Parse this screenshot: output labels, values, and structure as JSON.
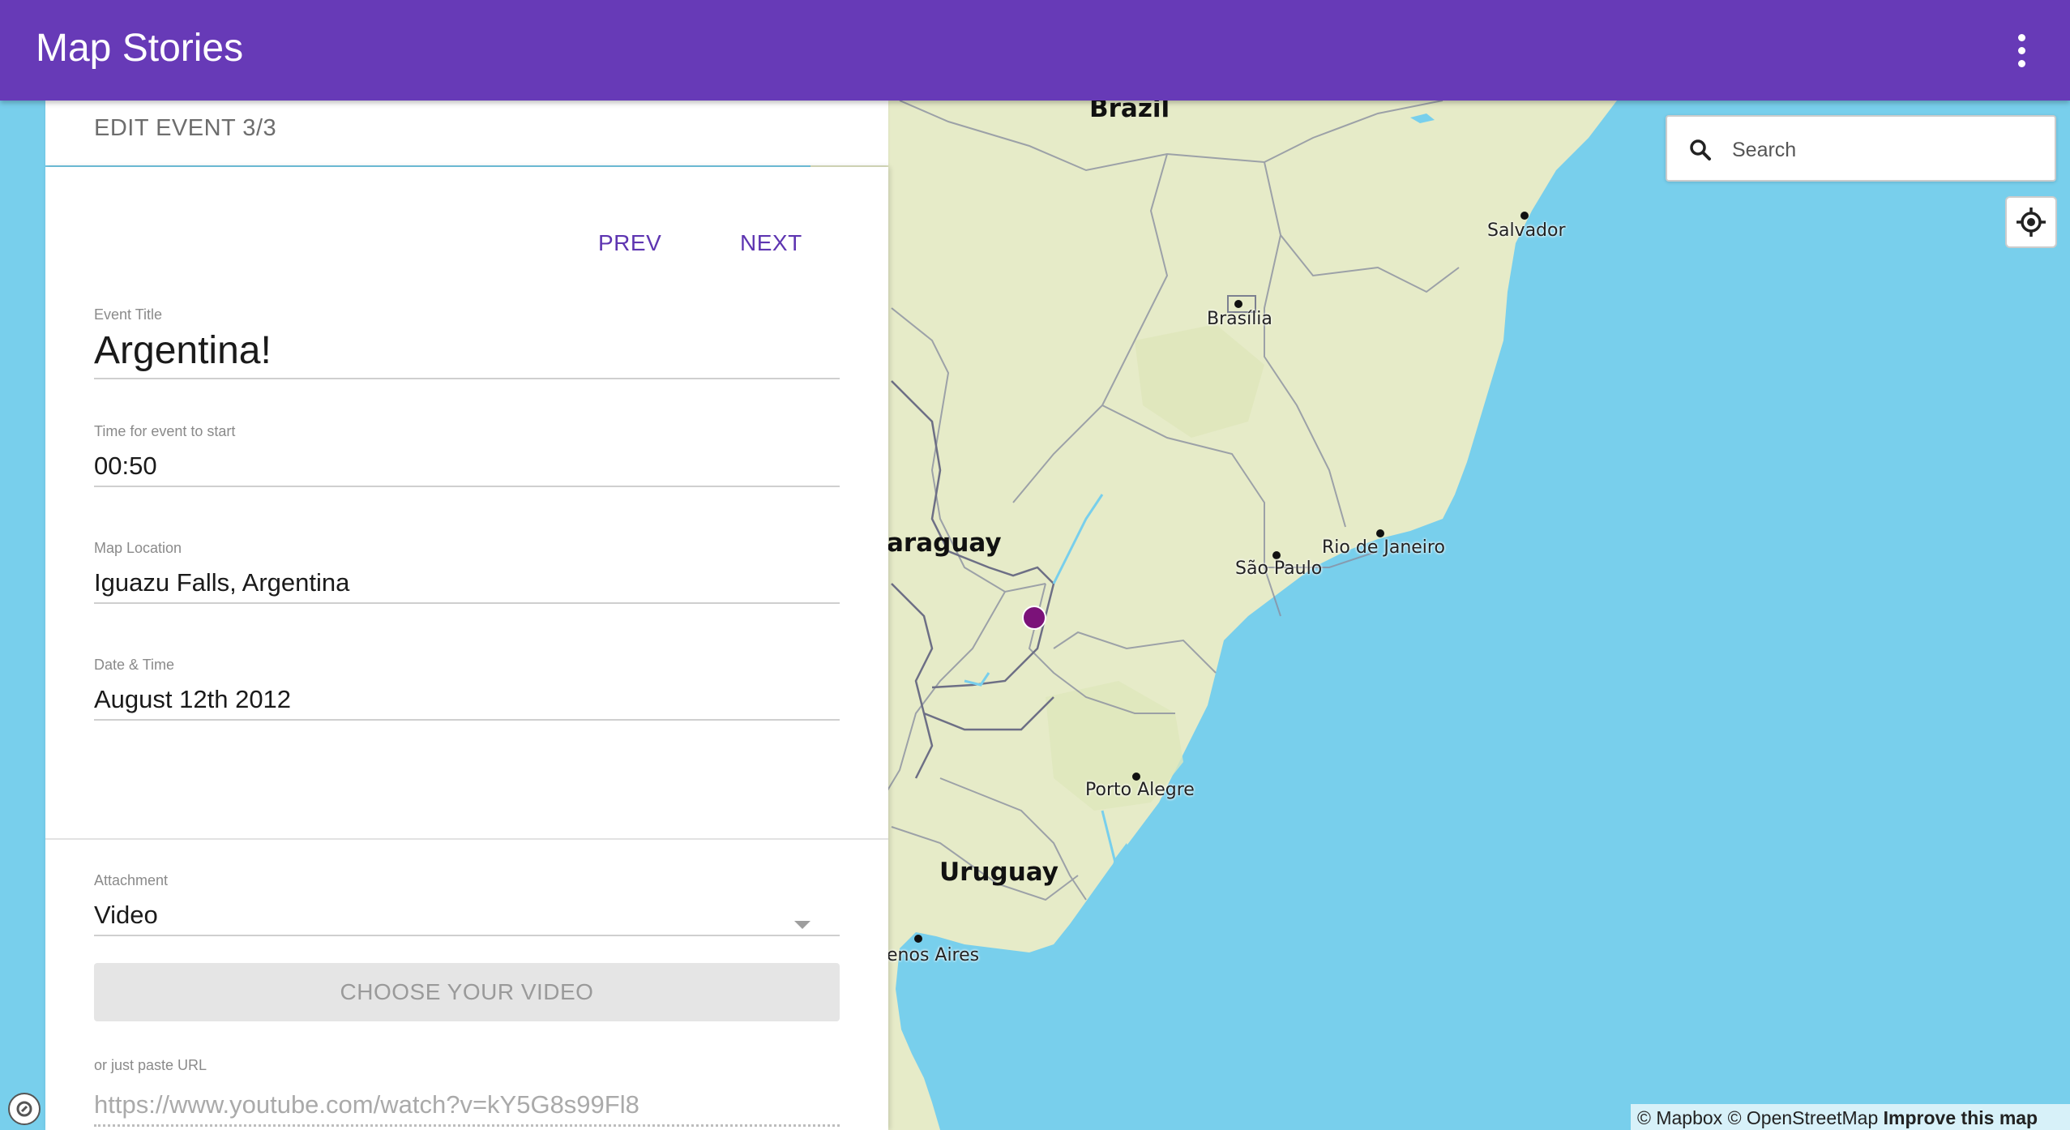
{
  "app": {
    "title": "Map Stories"
  },
  "editor": {
    "header": "EDIT EVENT 3/3",
    "prev_label": "PREV",
    "next_label": "NEXT",
    "event_title": {
      "label": "Event Title",
      "value": "Argentina!"
    },
    "start_time": {
      "label": "Time for event to start",
      "value": "00:50"
    },
    "location": {
      "label": "Map Location",
      "value": "Iguazu Falls, Argentina"
    },
    "datetime": {
      "label": "Date & Time",
      "value": "August 12th 2012"
    },
    "attachment": {
      "label": "Attachment",
      "value": "Video"
    },
    "choose_label": "CHOOSE YOUR VIDEO",
    "url": {
      "label": "or just paste URL",
      "value": "https://www.youtube.com/watch?v=kY5G8s99Fl8"
    }
  },
  "search": {
    "placeholder": "Search"
  },
  "map": {
    "countries": [
      "Brazil",
      "araguay",
      "Uruguay"
    ],
    "cities": [
      "Salvador",
      "Brasília",
      "Rio de Janeiro",
      "São Paulo",
      "Porto Alegre",
      "enos Aires"
    ],
    "marker_color": "#7b1279",
    "ocean_color": "#78cfec",
    "land_color": "#e6ebc8"
  },
  "attribution": {
    "mapbox": "© Mapbox",
    "osm": "© OpenStreetMap",
    "improve": "Improve this map"
  },
  "icons": [
    "more-vert-icon",
    "search-icon",
    "geolocate-icon",
    "map-marker-icon",
    "caret-down-icon",
    "mapbox-logo-icon"
  ]
}
